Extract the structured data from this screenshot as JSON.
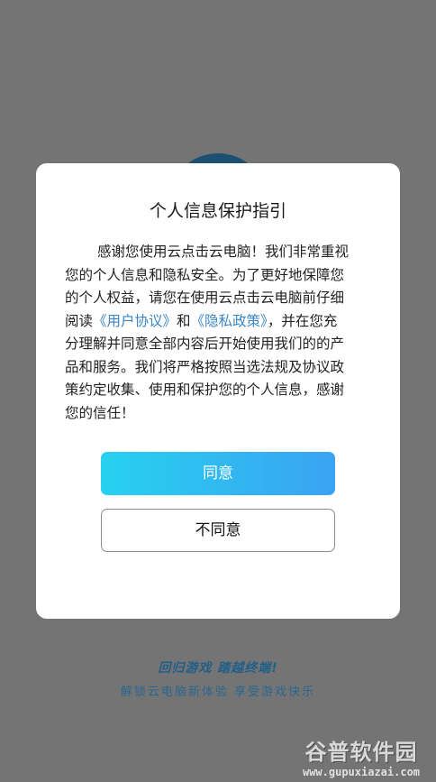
{
  "dialog": {
    "title": "个人信息保护指引",
    "body": {
      "line1": "感谢您使用云点击云电脑！我们非常重视",
      "line2": "您的个人信息和隐私安全。为了更好地保障您",
      "line3": "的个人权益，请您在使用云点击云电脑前仔细",
      "line4_prefix": "阅读",
      "user_agreement_link": "《用户协议》",
      "line4_and": "和",
      "privacy_policy_link": "《隐私政策》",
      "line4_suffix": "，并在您充",
      "line5": "分理解并同意全部内容后开始使用我们的的产",
      "line6": "品和服务。我们将严格按照当选法规及协议政",
      "line7": "策约定收集、使用和保护您的个人信息，感谢",
      "line8": "您的信任！"
    },
    "agree_label": "同意",
    "disagree_label": "不同意"
  },
  "background": {
    "slogan": "回归游戏 踏越终端!",
    "subtitle": "解锁云电脑新体验 享受游戏快乐"
  },
  "watermark": {
    "title": "谷普软件园",
    "url": "www.gupuxiazai.com"
  },
  "colors": {
    "overlay": "#747474",
    "link": "#3b86c5",
    "agree_gradient_start": "#27d1ef",
    "agree_gradient_end": "#3aa3f3"
  }
}
